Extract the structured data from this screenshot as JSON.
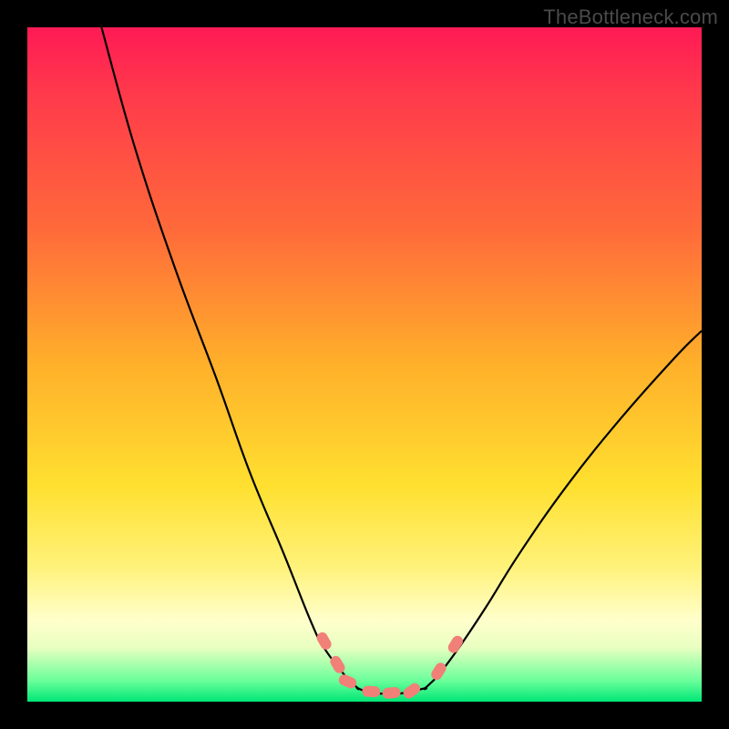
{
  "watermark": "TheBottleneck.com",
  "chart_data": {
    "type": "line",
    "title": "",
    "xlabel": "",
    "ylabel": "",
    "xlim": [
      0,
      100
    ],
    "ylim": [
      0,
      100
    ],
    "grid": false,
    "legend": false,
    "series": [
      {
        "name": "left-branch",
        "x": [
          11,
          16,
          22,
          28,
          33,
          38,
          42,
          44,
          47,
          49
        ],
        "y": [
          100,
          82,
          64,
          48,
          34,
          22,
          12,
          8,
          4,
          2
        ]
      },
      {
        "name": "right-branch",
        "x": [
          59,
          61,
          64,
          68,
          73,
          80,
          88,
          96,
          100
        ],
        "y": [
          2,
          4,
          8,
          14,
          22,
          32,
          42,
          51,
          55
        ]
      },
      {
        "name": "bottom-flat",
        "x": [
          49,
          51,
          54,
          56,
          59
        ],
        "y": [
          2,
          1.3,
          1.2,
          1.3,
          2
        ]
      }
    ],
    "series_markers": [
      {
        "name": "bottom-markers",
        "points": [
          {
            "x": 44,
            "y": 9
          },
          {
            "x": 46,
            "y": 5.5
          },
          {
            "x": 47.5,
            "y": 3
          },
          {
            "x": 51,
            "y": 1.5
          },
          {
            "x": 54,
            "y": 1.3
          },
          {
            "x": 57,
            "y": 1.6
          },
          {
            "x": 61,
            "y": 4.5
          },
          {
            "x": 63.5,
            "y": 8.5
          }
        ]
      }
    ],
    "colors": {
      "curve": "#000000",
      "marker_fill": "#f08078",
      "marker_stroke": "#d85a52",
      "gradient_top": "#ff1a55",
      "gradient_bottom": "#00e676"
    }
  }
}
